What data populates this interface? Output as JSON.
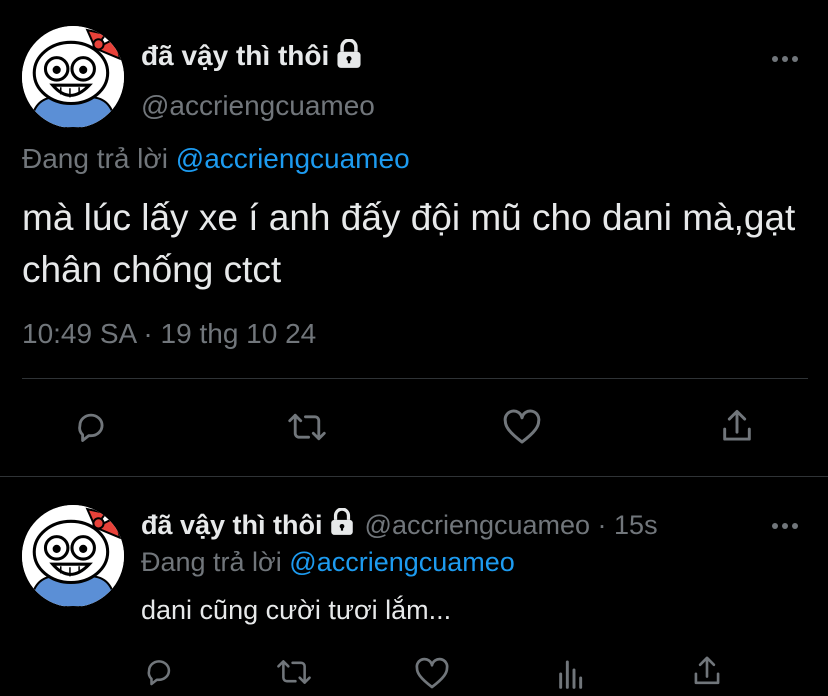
{
  "main_tweet": {
    "display_name": "đã vậy thì thôi",
    "handle": "@accriengcuameo",
    "reply_prefix": "Đang trả lời",
    "reply_to": "@accriengcuameo",
    "text": "mà lúc lấy xe í anh đấy đội mũ cho dani mà,gạt chân chống ctct",
    "timestamp": "10:49 SA · 19 thg 10 24",
    "icons": [
      "lock-icon",
      "more-icon",
      "reply-icon",
      "retweet-icon",
      "like-icon",
      "share-icon"
    ]
  },
  "reply_tweet": {
    "display_name": "đã vậy thì thôi",
    "handle_time": "@accriengcuameo · 15s",
    "reply_prefix": "Đang trả lời",
    "reply_to": "@accriengcuameo",
    "text": "dani cũng cười tươi lắm...",
    "icons": [
      "lock-icon",
      "more-icon",
      "reply-icon",
      "retweet-icon",
      "like-icon",
      "analytics-icon",
      "share-icon"
    ]
  },
  "colors": {
    "background": "#000000",
    "text": "#e7e9ea",
    "muted": "#71767b",
    "link": "#1d9bf0",
    "divider": "#2f3336",
    "avatar_bow": "#e8423a",
    "avatar_shirt": "#5b8fd6"
  }
}
